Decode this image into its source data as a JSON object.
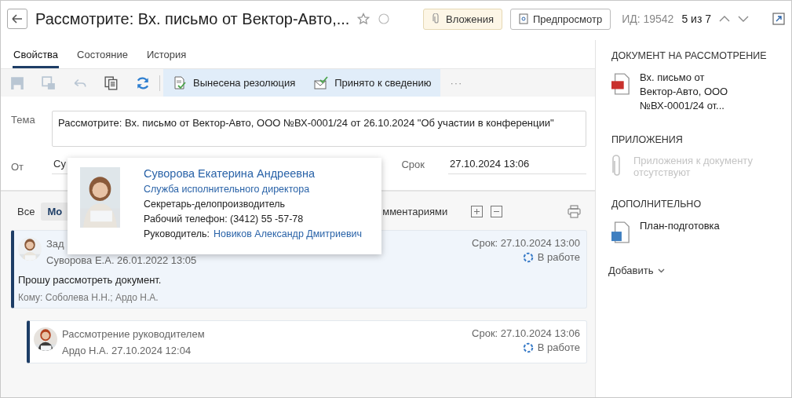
{
  "header": {
    "title": "Рассмотрите: Вх. письмо от Вектор-Авто,...",
    "starred": false,
    "buttons": [
      {
        "label": "Вложения",
        "kind": "attachments"
      },
      {
        "label": "Предпросмотр",
        "kind": "preview"
      }
    ],
    "id_label": "ИД: 19542",
    "position": "5 из 7"
  },
  "tabs": [
    {
      "label": "Свойства",
      "selected": true
    },
    {
      "label": "Состояние",
      "selected": false
    },
    {
      "label": "История",
      "selected": false
    }
  ],
  "toolbar": {
    "tools": [
      {
        "kind": "save",
        "disabled": true
      },
      {
        "kind": "save-as",
        "disabled": true
      },
      {
        "kind": "undo",
        "disabled": true
      },
      {
        "kind": "copy",
        "disabled": false
      },
      {
        "kind": "refresh",
        "disabled": false
      }
    ],
    "actions": [
      {
        "label": "Вынесена резолюция",
        "kind": "resolution"
      },
      {
        "label": "Принято к сведению",
        "kind": "accepted"
      }
    ],
    "more": "···"
  },
  "form": {
    "subject_label": "Тема",
    "subject": "Рассмотрите: Вх. письмо от Вектор-Авто, ООО №ВХ-0001/24 от 26.10.2024 \"Об участии в конференции\"",
    "from_label": "От",
    "from_value": "Су",
    "deadline_label": "Срок",
    "deadline": "27.10.2024 13:06"
  },
  "filters": [
    {
      "label": "Все",
      "selected": false
    },
    {
      "label": "Мо",
      "selected": true
    },
    {
      "label": "мментариями",
      "selected": false
    }
  ],
  "tasks": [
    {
      "title": "Зад",
      "author_date": "Суворова Е.А.  26.01.2022 13:05",
      "deadline": "Срок: 27.10.2024 13:00",
      "status": "В работе",
      "text": "Прошу рассмотреть документ.",
      "recipients": "Кому: Соболева Н.Н.; Ардо Н.А.",
      "selected": true,
      "children": [
        {
          "title": "Рассмотрение руководителем",
          "author_date": "Ардо Н.А.  27.10.2024 12:04",
          "deadline": "Срок: 27.10.2024 13:06",
          "status": "В работе",
          "selected": false
        }
      ]
    }
  ],
  "contact_card": {
    "name": "Суворова Екатерина Андреевна",
    "department": "Служба исполнительного директора",
    "position": "Секретарь-делопроизводитель",
    "phone": "Рабочий телефон: (3412) 55 -57-78",
    "manager_label": "Руководитель:",
    "manager": "Новиков Александр Дмитриевич"
  },
  "sidebar": {
    "sections": [
      {
        "title": "ДОКУМЕНТ НА РАССМОТРЕНИЕ",
        "items": [
          {
            "kind": "pdf",
            "name": "Вх. письмо от Вектор-Авто, ООО №ВХ-0001/24 от..."
          }
        ]
      },
      {
        "title": "ПРИЛОЖЕНИЯ",
        "empty": "Приложения к документу отсутствуют"
      },
      {
        "title": "ДОПОЛНИТЕЛЬНО",
        "items": [
          {
            "kind": "word",
            "name": "План-подготовка"
          }
        ]
      }
    ],
    "add": "Добавить"
  }
}
